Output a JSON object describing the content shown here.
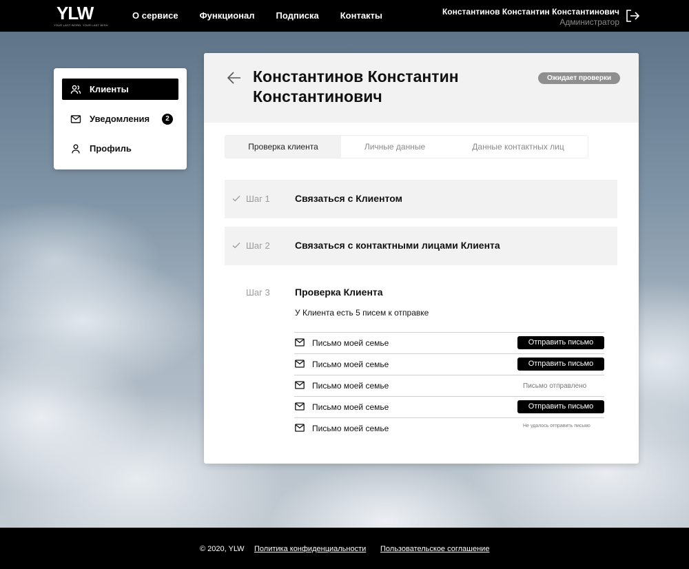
{
  "header": {
    "logo_text": "YLW",
    "logo_tagline": "YOUR LAST WORD. YOUR LAST WISH",
    "nav": [
      "О сервисе",
      "Функционал",
      "Подписка",
      "Контакты"
    ],
    "user_name": "Константинов Константин Константинович",
    "user_role": "Администратор",
    "logout_icon": "logout-icon"
  },
  "sidebar": {
    "items": [
      {
        "label": "Клиенты",
        "icon": "users-icon",
        "active": true
      },
      {
        "label": "Уведомления",
        "icon": "mail-icon",
        "badge": "2"
      },
      {
        "label": "Профиль",
        "icon": "user-icon"
      }
    ]
  },
  "client": {
    "name": "Константинов Константин Константинович",
    "status": "Ожидает проверки"
  },
  "tabs": [
    "Проверка клиента",
    "Личные данные",
    "Данные контактных лиц"
  ],
  "steps": [
    {
      "num": "Шаг 1",
      "title": "Связаться с Клиентом",
      "done": true
    },
    {
      "num": "Шаг 2",
      "title": "Связаться с контактными лицами Клиента",
      "done": true
    },
    {
      "num": "Шаг 3",
      "title": "Проверка Клиента",
      "done": false
    }
  ],
  "step3": {
    "info": "У Клиента есть 5 писем к отправке",
    "letters": [
      {
        "name": "Письмо моей семье",
        "action": "Отправить письмо"
      },
      {
        "name": "Письмо моей семье",
        "action": "Отправить письмо"
      },
      {
        "name": "Письмо моей семье",
        "status": "Письмо отправлено"
      },
      {
        "name": "Письмо моей семье",
        "action": "Отправить письмо"
      },
      {
        "name": "Письмо моей семье",
        "status": "Не удалось отправить письмо"
      }
    ]
  },
  "footer": {
    "copyright": "© 2020, YLW",
    "privacy": "Политика конфиденциальности",
    "terms": "Пользовательское соглашение"
  },
  "colors": {
    "header_bg": "#000000",
    "accent": "#000000",
    "status_badge": "#8f8f8f",
    "panel_gray": "#f2f2f2"
  }
}
